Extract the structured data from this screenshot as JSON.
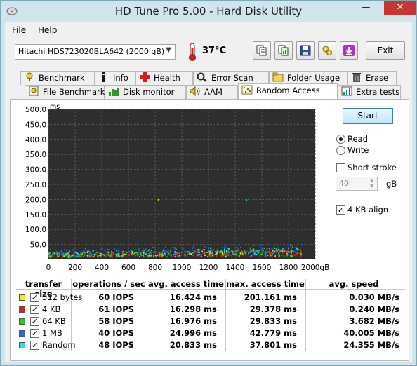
{
  "window": {
    "title": "HD Tune Pro 5.00 - Hard Disk Utility",
    "min_glyph": "—",
    "max_glyph": "☐",
    "close_glyph": "✕"
  },
  "menu": {
    "file_label": "File",
    "help_label": "Help"
  },
  "toolbar": {
    "drive": "Hitachi HDS723020BLA642 (2000 gB)",
    "temperature": "37°C",
    "exit_label": "Exit",
    "icons": [
      "copy-info-icon",
      "copy-screen-icon",
      "save-icon",
      "options-icon",
      "download-icon"
    ]
  },
  "tabs_row1": [
    {
      "label": "Benchmark",
      "icon": "benchmark-icon"
    },
    {
      "label": "Info",
      "icon": "info-icon"
    },
    {
      "label": "Health",
      "icon": "health-icon"
    },
    {
      "label": "Error Scan",
      "icon": "error-scan-icon"
    },
    {
      "label": "Folder Usage",
      "icon": "folder-icon"
    },
    {
      "label": "Erase",
      "icon": "erase-icon"
    }
  ],
  "tabs_row2": [
    {
      "label": "File Benchmark",
      "icon": "file-benchmark-icon"
    },
    {
      "label": "Disk monitor",
      "icon": "disk-monitor-icon"
    },
    {
      "label": "AAM",
      "icon": "speaker-icon"
    },
    {
      "label": "Random Access",
      "icon": "random-access-icon",
      "active": true
    },
    {
      "label": "Extra tests",
      "icon": "extra-tests-icon"
    }
  ],
  "controls": {
    "start_label": "Start",
    "read_label": "Read",
    "write_label": "Write",
    "mode_selected": "Read",
    "short_stroke_label": "Short stroke",
    "short_stroke_checked": false,
    "stroke_value": "40",
    "stroke_unit": "gB",
    "align_label": "4 KB align",
    "align_checked": true
  },
  "chart_data": {
    "type": "scatter",
    "y_unit": "ms",
    "x_unit": "gB",
    "xlim": [
      0,
      2000
    ],
    "ylim": [
      0,
      500
    ],
    "x_ticks": [
      "0",
      "200",
      "400",
      "600",
      "800",
      "1000",
      "1200",
      "1400",
      "1600",
      "1800",
      "2000gB"
    ],
    "y_ticks": [
      "500.0",
      "450.0",
      "400.0",
      "350.0",
      "300.0",
      "250.0",
      "200.0",
      "150.0",
      "100.0",
      "50.0"
    ],
    "grid": true,
    "background": "#2e2e2e",
    "series": [
      {
        "name": "512 bytes",
        "color": "#f2f200",
        "avg_ms": 16.424,
        "max_ms": 201.161
      },
      {
        "name": "4 KB",
        "color": "#e81e1e",
        "avg_ms": 16.298,
        "max_ms": 29.378
      },
      {
        "name": "64 KB",
        "color": "#28c828",
        "avg_ms": 16.976,
        "max_ms": 29.833
      },
      {
        "name": "1 MB",
        "color": "#1e6ee8",
        "avg_ms": 24.996,
        "max_ms": 42.779
      },
      {
        "name": "Random",
        "color": "#19e6e6",
        "avg_ms": 20.833,
        "max_ms": 37.801
      }
    ],
    "outliers": [
      {
        "x": 820,
        "y": 201,
        "series": "512 bytes"
      },
      {
        "x": 1480,
        "y": 200,
        "series": "Random"
      }
    ]
  },
  "table": {
    "headers": [
      "transfer size",
      "operations / sec",
      "avg. access time",
      "max. access time",
      "avg. speed"
    ],
    "rows": [
      {
        "name": "512 bytes",
        "ops": "60 IOPS",
        "avg": "16.424 ms",
        "max": "201.161 ms",
        "speed": "0.030 MB/s",
        "color": "#f2f200",
        "checked": true
      },
      {
        "name": "4 KB",
        "ops": "61 IOPS",
        "avg": "16.298 ms",
        "max": "29.378 ms",
        "speed": "0.240 MB/s",
        "color": "#e81e1e",
        "checked": true
      },
      {
        "name": "64 KB",
        "ops": "58 IOPS",
        "avg": "16.976 ms",
        "max": "29.833 ms",
        "speed": "3.682 MB/s",
        "color": "#28c828",
        "checked": true
      },
      {
        "name": "1 MB",
        "ops": "40 IOPS",
        "avg": "24.996 ms",
        "max": "42.779 ms",
        "speed": "40.005 MB/s",
        "color": "#1e6ee8",
        "checked": true
      },
      {
        "name": "Random",
        "ops": "48 IOPS",
        "avg": "20.833 ms",
        "max": "37.801 ms",
        "speed": "24.355 MB/s",
        "color": "#19e6e6",
        "checked": true
      }
    ]
  }
}
